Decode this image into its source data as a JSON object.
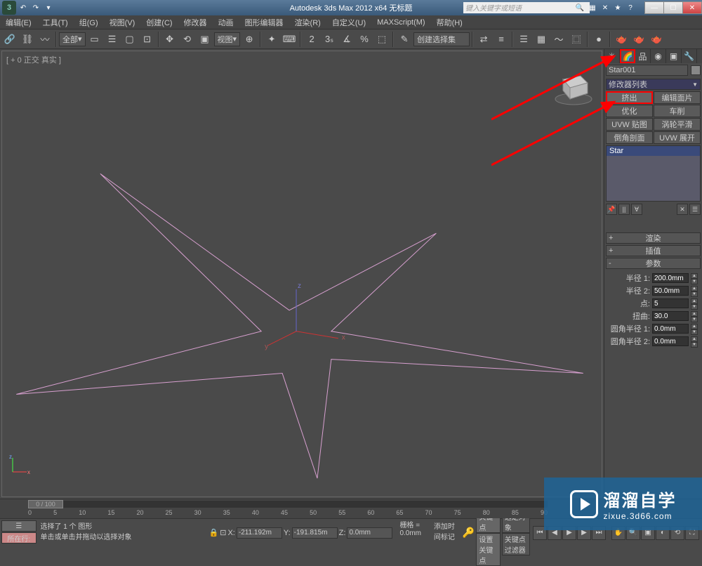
{
  "titlebar": {
    "app_title": "Autodesk 3ds Max  2012 x64   无标题",
    "search_placeholder": "键入关键字或短语"
  },
  "menubar": {
    "items": [
      "编辑(E)",
      "工具(T)",
      "组(G)",
      "视图(V)",
      "创建(C)",
      "修改器",
      "动画",
      "图形编辑器",
      "渲染(R)",
      "自定义(U)",
      "MAXScript(M)",
      "帮助(H)"
    ]
  },
  "toolbar": {
    "scope_dropdown": "全部",
    "view_dropdown": "视图",
    "selection_dropdown": "创建选择集"
  },
  "viewport": {
    "label": "[ + 0  正交  真实  ]"
  },
  "command_panel": {
    "object_name": "Star001",
    "modifier_list_label": "修改器列表",
    "mod_buttons": [
      "挤出",
      "编辑面片",
      "优化",
      "车削",
      "UVW 贴图",
      "涡轮平滑",
      "倒角剖面",
      "UVW 展开"
    ],
    "stack_item": "Star",
    "rollouts": {
      "render": "渲染",
      "interp": "插值",
      "params": "参数"
    },
    "params": {
      "radius1_label": "半径 1:",
      "radius1_value": "200.0mm",
      "radius2_label": "半径 2:",
      "radius2_value": "50.0mm",
      "points_label": "点:",
      "points_value": "5",
      "distortion_label": "扭曲:",
      "distortion_value": "30.0",
      "fillet1_label": "圆角半径 1:",
      "fillet1_value": "0.0mm",
      "fillet2_label": "圆角半径 2:",
      "fillet2_value": "0.0mm"
    }
  },
  "timeline": {
    "frame_label": "0 / 100",
    "ticks": [
      "0",
      "5",
      "10",
      "15",
      "20",
      "25",
      "30",
      "35",
      "40",
      "45",
      "50",
      "55",
      "60",
      "65",
      "70",
      "75",
      "80",
      "85",
      "90"
    ]
  },
  "statusbar": {
    "row_label": "所在行:",
    "prompt1": "选择了 1 个 图形",
    "prompt2": "单击或单击并拖动以选择对象",
    "lock_icon": "🔒",
    "x_label": "X:",
    "x_value": "-211.192m",
    "y_label": "Y:",
    "y_value": "-191.815m",
    "z_label": "Z:",
    "z_value": "0.0mm",
    "grid_label": "栅格 = 0.0mm",
    "add_marker": "添加时间标记",
    "autokey": "自动关键点",
    "setkey": "设置关键点",
    "selected": "选定对象",
    "keyfilter": "关键点过滤器"
  },
  "watermark": {
    "cn": "溜溜自学",
    "en": "zixue.3d66.com"
  },
  "chart_data": null
}
